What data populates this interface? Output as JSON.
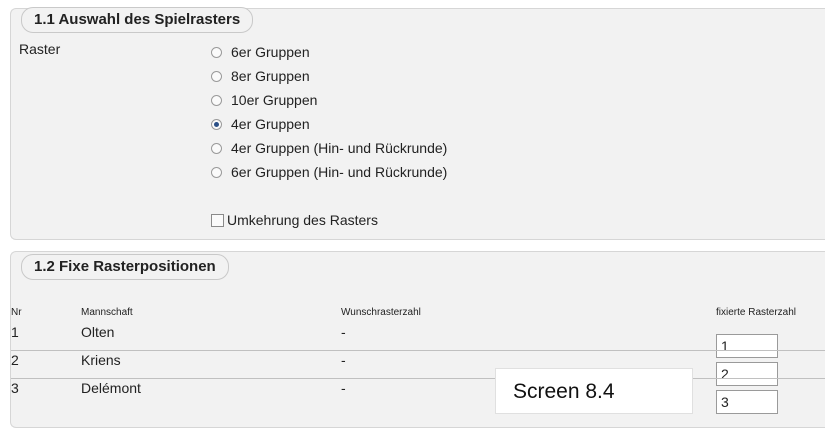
{
  "section1": {
    "title": "1.1 Auswahl des Spielrasters",
    "raster_label": "Raster",
    "options": [
      {
        "label": "6er Gruppen",
        "checked": false
      },
      {
        "label": "8er Gruppen",
        "checked": false
      },
      {
        "label": "10er Gruppen",
        "checked": false
      },
      {
        "label": "4er Gruppen",
        "checked": true
      },
      {
        "label": "4er Gruppen (Hin- und Rückrunde)",
        "checked": false
      },
      {
        "label": "6er Gruppen (Hin- und Rückrunde)",
        "checked": false
      }
    ],
    "invert_label": "Umkehrung des Rasters",
    "invert_checked": false
  },
  "section2": {
    "title": "1.2 Fixe Rasterpositionen",
    "headers": {
      "nr": "Nr",
      "team": "Mannschaft",
      "wish": "Wunschrasterzahl",
      "fixed": "fixierte Rasterzahl"
    },
    "rows": [
      {
        "nr": "1",
        "team": "Olten",
        "wish": "-",
        "fixed": "1"
      },
      {
        "nr": "2",
        "team": "Kriens",
        "wish": "-",
        "fixed": "2"
      },
      {
        "nr": "3",
        "team": "Delémont",
        "wish": "-",
        "fixed": "3"
      }
    ]
  },
  "watermark": "Screen 8.4"
}
